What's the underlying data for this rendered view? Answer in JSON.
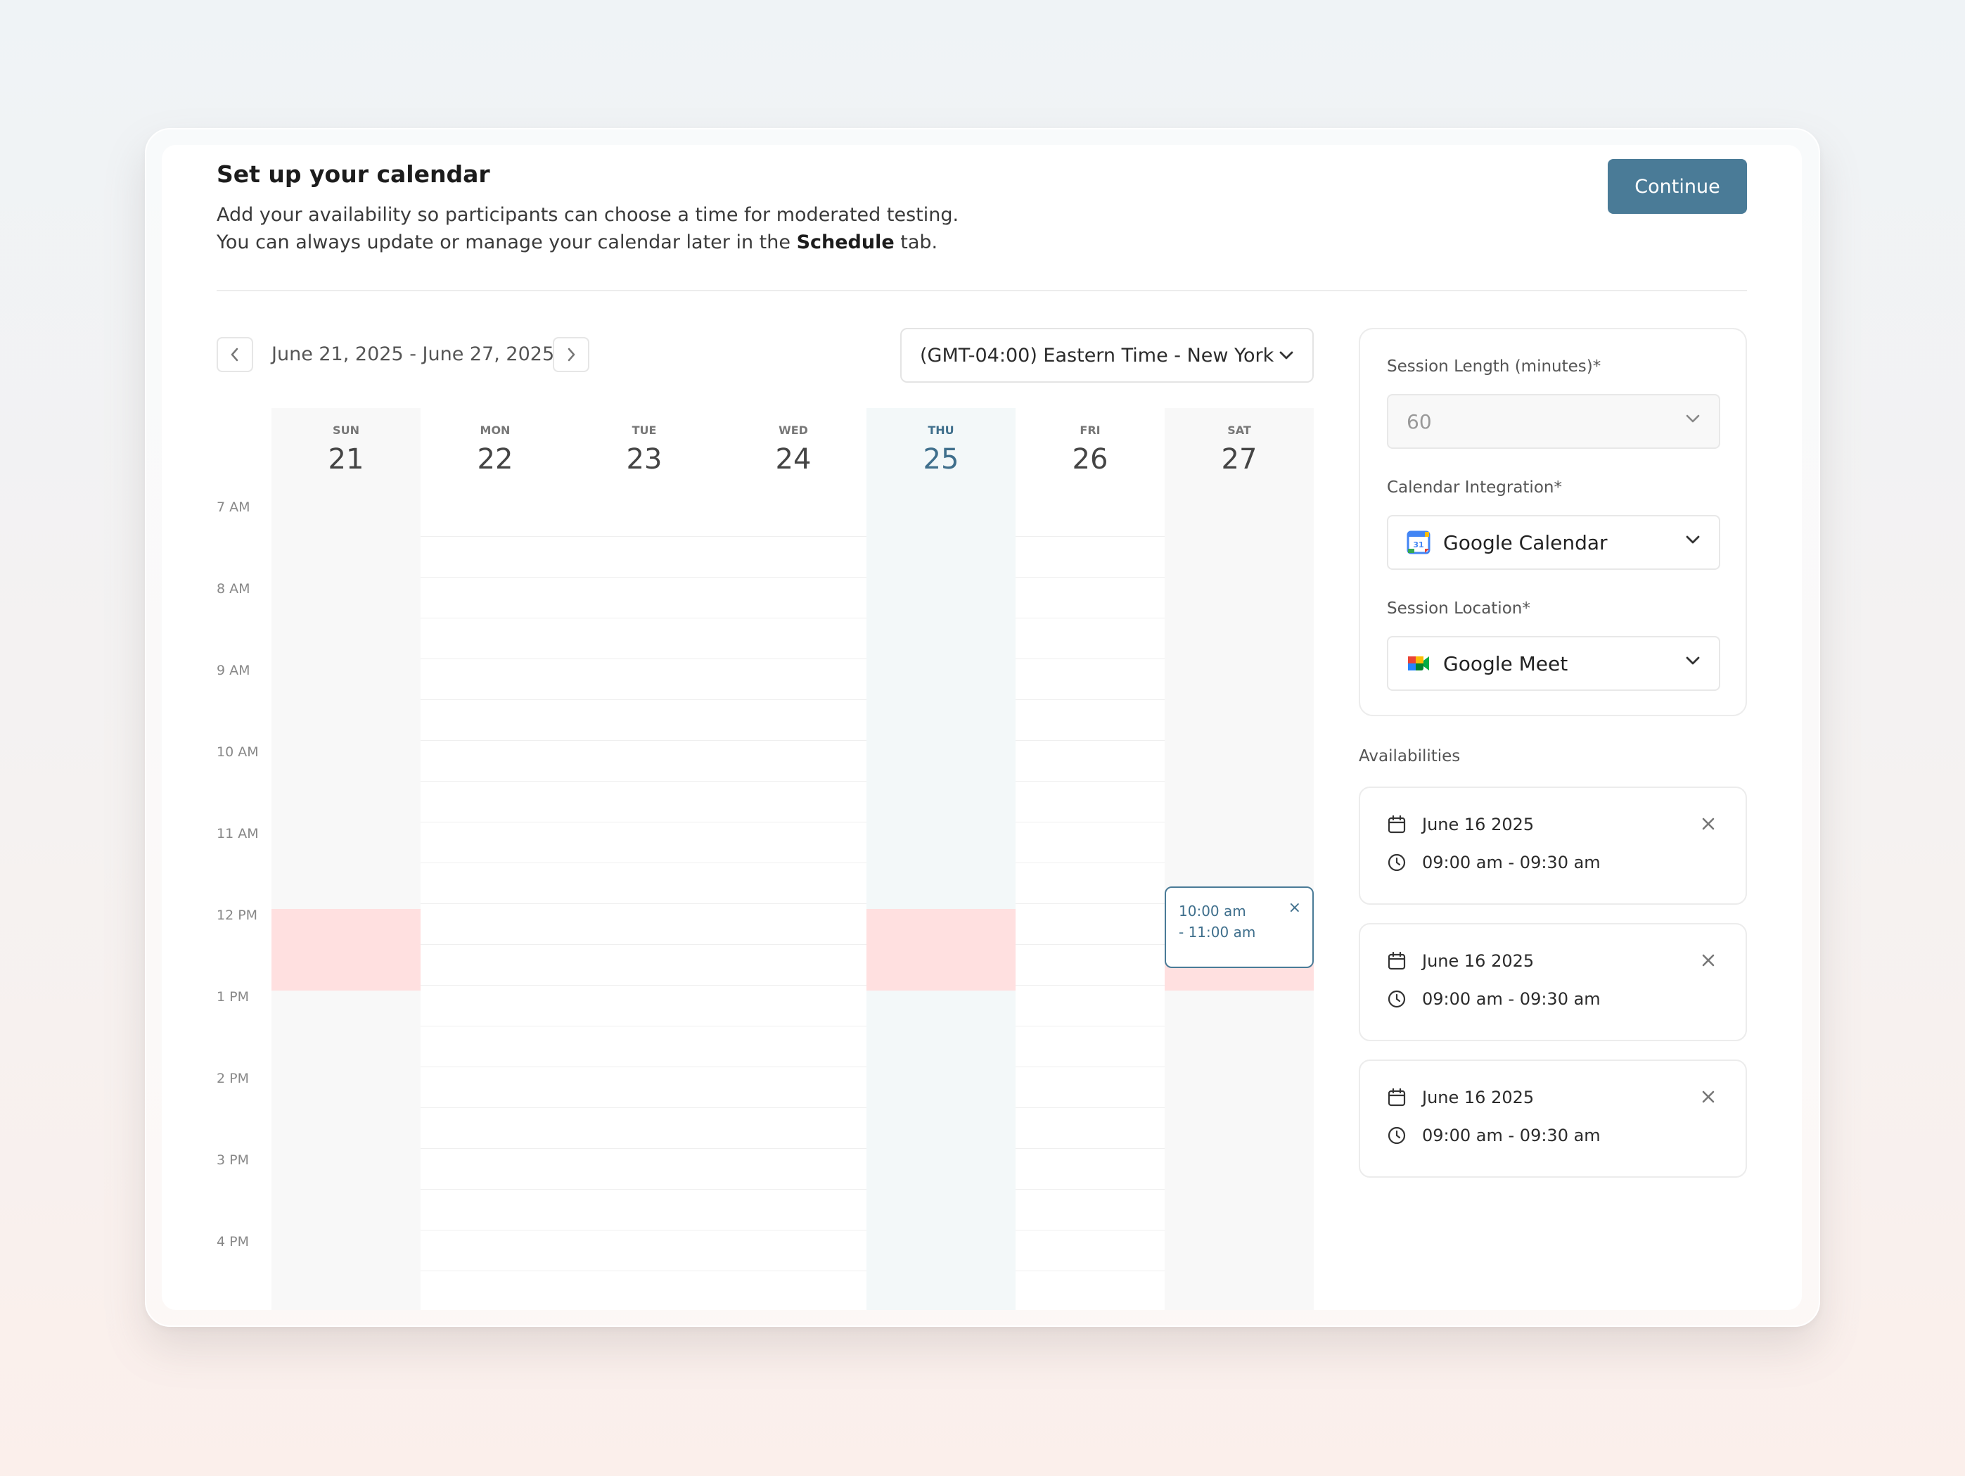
{
  "header": {
    "title": "Set up your calendar",
    "desc_line1": "Add your availability so participants can choose a time for moderated testing.",
    "desc_line2_pre": "You can always update or manage your calendar later in the ",
    "desc_line2_bold": "Schedule",
    "desc_line2_post": " tab.",
    "continue_label": "Continue"
  },
  "calendar": {
    "week_range": "June 21, 2025 - June 27, 2025",
    "timezone": "(GMT-04:00) Eastern Time - New York",
    "days": [
      {
        "name": "SUN",
        "num": "21"
      },
      {
        "name": "MON",
        "num": "22"
      },
      {
        "name": "TUE",
        "num": "23"
      },
      {
        "name": "WED",
        "num": "24"
      },
      {
        "name": "THU",
        "num": "25"
      },
      {
        "name": "FRI",
        "num": "26"
      },
      {
        "name": "SAT",
        "num": "27"
      }
    ],
    "times": [
      "7 AM",
      "8 AM",
      "9 AM",
      "10 AM",
      "11 AM",
      "12 PM",
      "1 PM",
      "2 PM",
      "3 PM",
      "4 PM"
    ],
    "slot": {
      "line1": "10:00 am",
      "line2": "- 11:00 am",
      "close": "×"
    }
  },
  "settings": {
    "session_length_label": "Session Length (minutes)*",
    "session_length_value": "60",
    "calendar_integration_label": "Calendar Integration*",
    "calendar_integration_value": "Google Calendar",
    "session_location_label": "Session Location*",
    "session_location_value": "Google Meet"
  },
  "availabilities": {
    "title": "Availabilities",
    "items": [
      {
        "date": "June 16 2025",
        "time": "09:00 am - 09:30 am"
      },
      {
        "date": "June 16 2025",
        "time": "09:00 am - 09:30 am"
      },
      {
        "date": "June 16 2025",
        "time": "09:00 am - 09:30 am"
      }
    ]
  },
  "colors": {
    "accent": "#4a7b97",
    "blocked": "#ffe0e0",
    "today": "#f3f8f9"
  }
}
